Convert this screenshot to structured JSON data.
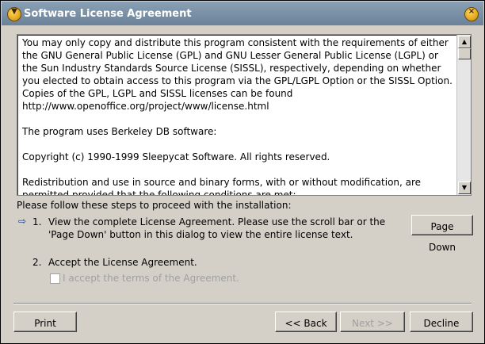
{
  "window": {
    "title": "Software License Agreement"
  },
  "license": {
    "paragraphs": [
      "You may only copy and distribute this program consistent with the requirements of either the GNU General Public License (GPL) and GNU Lesser General Public License (LGPL) or the Sun Industry Standards Source License (SISSL), respectively, depending on whether you elected to obtain access to this program via the GPL/LGPL Option or the SISSL Option. Copies of the GPL, LGPL and SISSL licenses can be found http://www.openoffice.org/project/www/license.html",
      "The program uses Berkeley DB software:",
      "Copyright (c) 1990-1999 Sleepycat Software.  All rights reserved.",
      "Redistribution and use in source and binary forms, with or without modification, are permitted provided that the following conditions are met:"
    ]
  },
  "instructions": {
    "intro": "Please follow these steps to proceed with the installation:",
    "step1_num": "1.",
    "step1_line1": "View the complete License Agreement. Please use the scroll bar or the",
    "step1_line2": "'Page Down' button in this dialog to view the entire license text.",
    "step2_num": "2.",
    "step2_text": "Accept the License Agreement.",
    "accept_label": "I accept the terms of the Agreement."
  },
  "buttons": {
    "page_down": "Page Down",
    "print": "Print",
    "back": "<< Back",
    "next": "Next >>",
    "decline": "Decline"
  }
}
